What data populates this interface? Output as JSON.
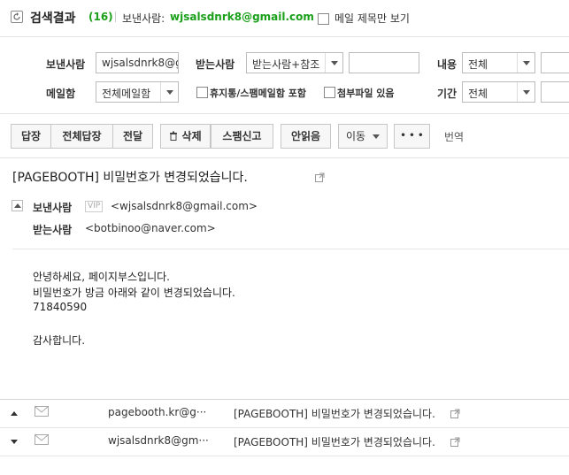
{
  "header": {
    "title": "검색결과",
    "count": "(16)",
    "sender_label": "보낸사람:",
    "sender_value": "wjsalsdnrk8@gmail.com",
    "title_only_label": "메일 제목만 보기"
  },
  "filters": {
    "from_label": "보낸사람",
    "from_value": "wjsalsdnrk8@gı",
    "to_label": "받는사람",
    "to_select": "받는사람+참조",
    "to_value": "",
    "content_label": "내용",
    "content_select": "전체",
    "content_value": "",
    "mailbox_label": "메일함",
    "mailbox_select": "전체메일함",
    "mobile_label": "휴지통/스팸메일함 포함",
    "attach_label": "첨부파일 있음",
    "period_label": "기간",
    "period_select": "전체",
    "period_value": ""
  },
  "toolbar": {
    "reply": "답장",
    "reply_all": "전체답장",
    "forward": "전달",
    "delete": "삭제",
    "spam": "스팸신고",
    "unread": "안읽음",
    "move": "이동",
    "more": "• • •",
    "translate": "번역"
  },
  "mail": {
    "subject": "[PAGEBOOTH] 비밀번호가 변경되었습니다.",
    "from_label": "보낸사람",
    "vip": "VIP",
    "from_value": "<wjsalsdnrk8@gmail.com>",
    "to_label": "받는사람",
    "to_value": "<botbinoo@naver.com>",
    "body": [
      "안녕하세요, 페이지부스입니다.",
      "비밀번호가 방금 아래와 같이 변경되었습니다.",
      "71840590",
      "",
      "감사합니다."
    ]
  },
  "list": [
    {
      "direction": "up",
      "sender": "pagebooth.kr@g···",
      "subject": "[PAGEBOOTH] 비밀번호가 변경되었습니다."
    },
    {
      "direction": "down",
      "sender": "wjsalsdnrk8@gm···",
      "subject": "[PAGEBOOTH] 비밀번호가 변경되었습니다."
    }
  ],
  "colors": {
    "accent_green": "#1aa01a"
  }
}
